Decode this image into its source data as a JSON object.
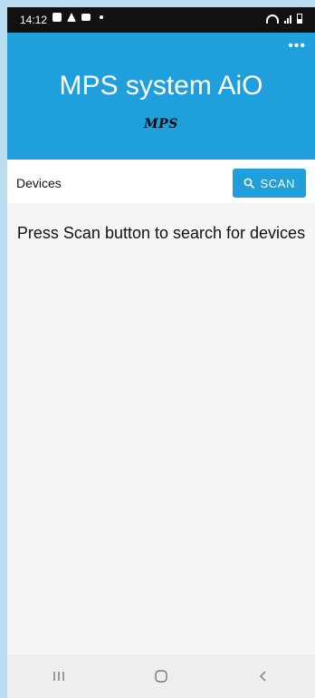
{
  "status_bar": {
    "time": "14:12",
    "left_icons": [
      "image-icon",
      "drive-icon",
      "mail-icon"
    ],
    "right_icons": [
      "wifi-icon",
      "signal-icon",
      "battery-icon"
    ]
  },
  "header": {
    "title": "MPS system AiO",
    "logo_text": "MPS",
    "menu_icon": "more-dots-icon",
    "background_color": "#1fa0dc"
  },
  "toolbar": {
    "label": "Devices",
    "scan_label": "SCAN",
    "scan_icon": "search-icon"
  },
  "main": {
    "message": "Press Scan button to search for devices"
  },
  "nav_bar": {
    "recent_icon": "recent-apps-icon",
    "home_icon": "home-icon",
    "back_icon": "back-icon"
  }
}
